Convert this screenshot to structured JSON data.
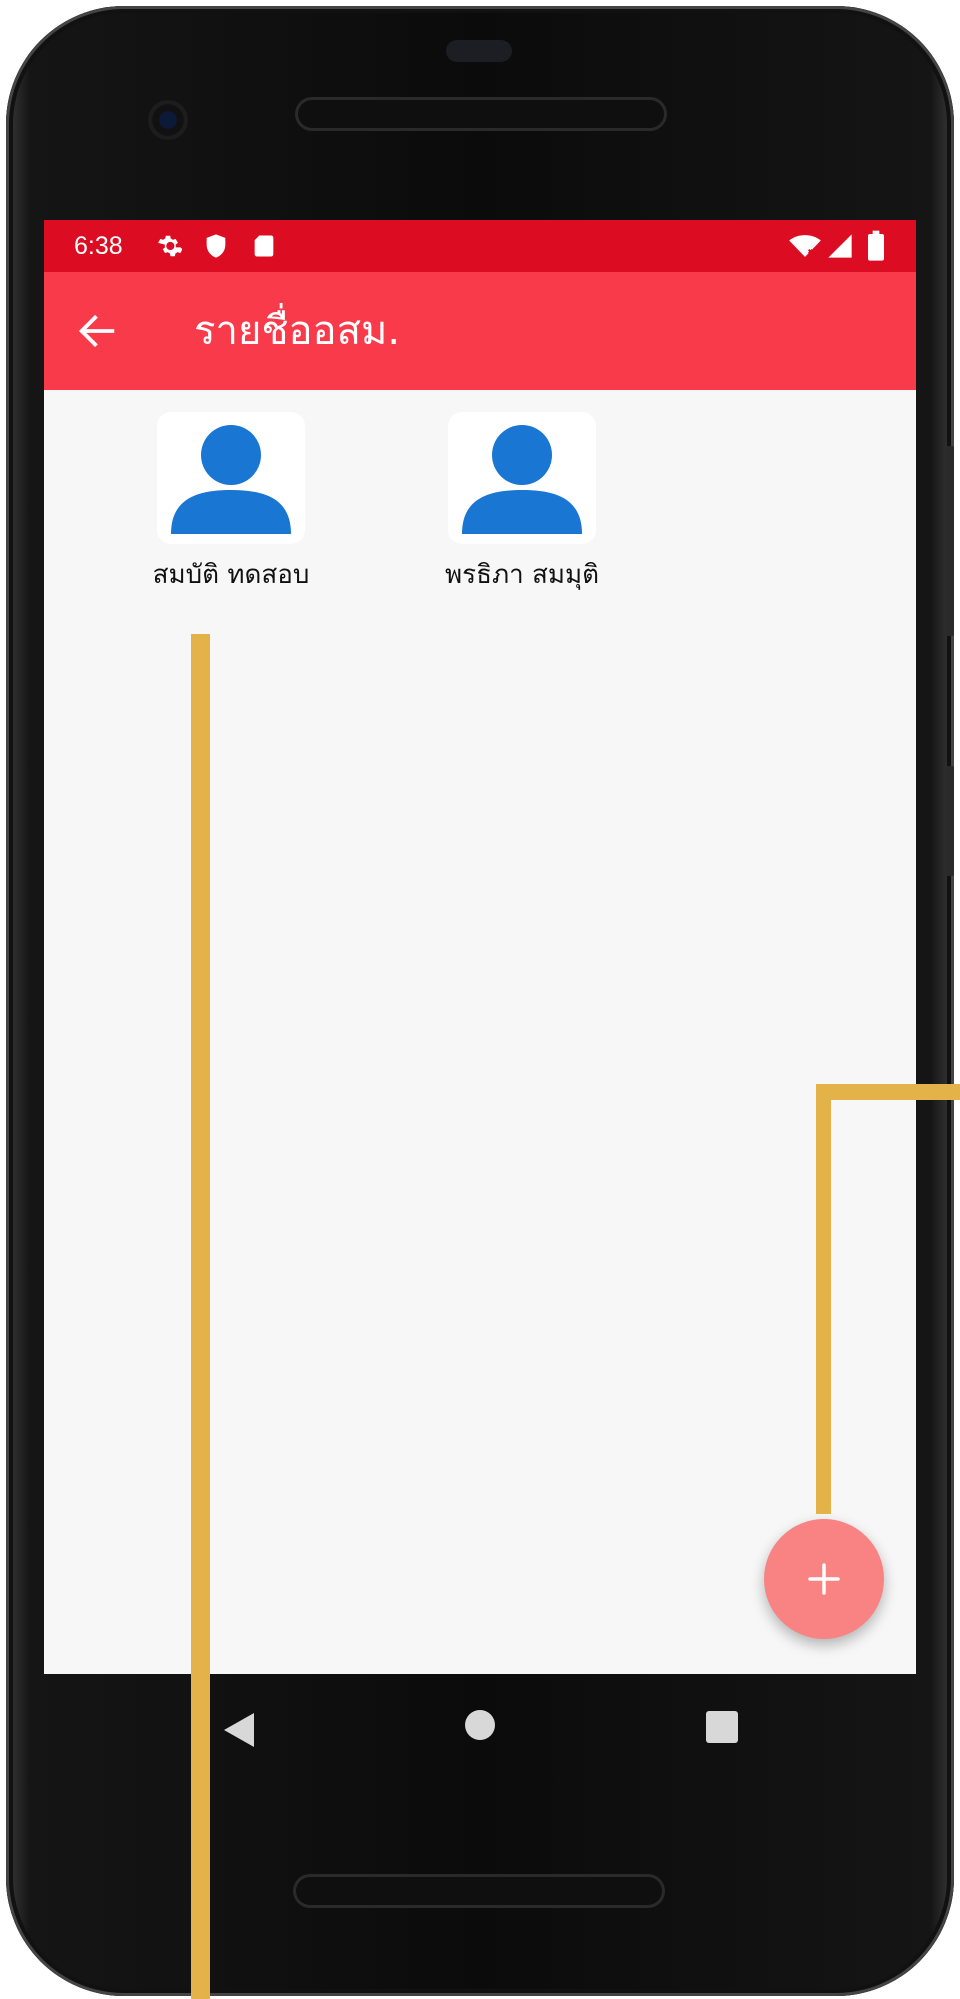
{
  "status_bar": {
    "time": "6:38",
    "left_icons": [
      "settings-icon",
      "shield-icon",
      "sd-card-icon"
    ],
    "right_icons": [
      "wifi-icon",
      "signal-icon",
      "battery-icon"
    ],
    "color": "#dc0d23"
  },
  "app_bar": {
    "title": "รายชื่ออสม.",
    "back_icon": "arrow-back-icon",
    "color": "#f93a4a"
  },
  "people": [
    {
      "name": "สมบัติ ทดสอบ",
      "icon": "person-icon"
    },
    {
      "name": "พรธิภา สมมุติ",
      "icon": "person-icon"
    }
  ],
  "fab": {
    "icon": "plus-icon",
    "color": "#f98282"
  },
  "nav_bar": {
    "buttons": [
      "back-triangle-icon",
      "home-circle-icon",
      "recent-square-icon"
    ]
  },
  "annotations": {
    "color": "#e3b249"
  }
}
